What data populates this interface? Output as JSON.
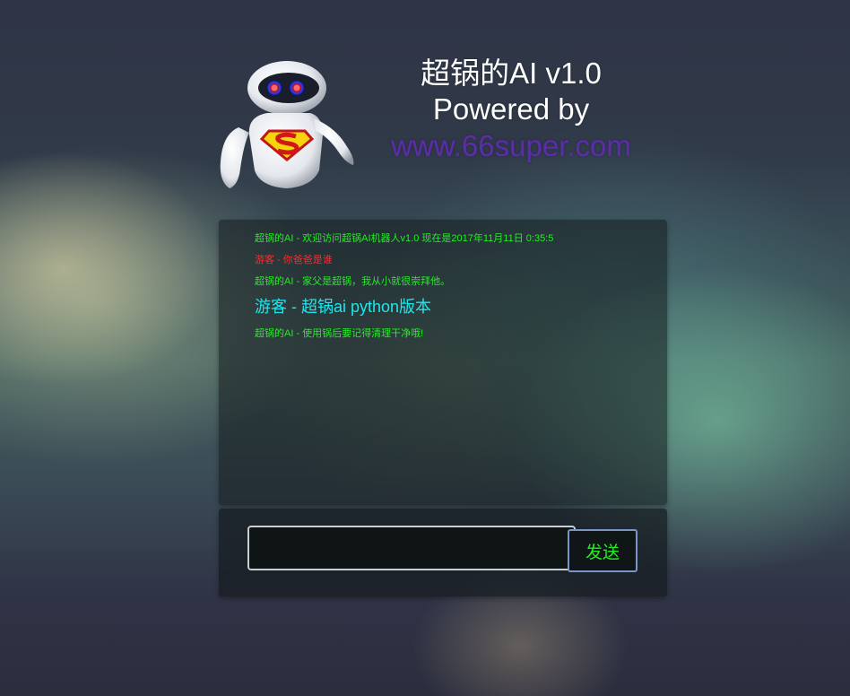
{
  "header": {
    "title": "超锅的AI v1.0",
    "powered": "Powered by",
    "site": "www.66super.com"
  },
  "chat": {
    "messages": [
      {
        "sender": "ai",
        "text": "超锅的AI - 欢迎访问超锅AI机器人v1.0 现在是2017年11月11日 0:35:5"
      },
      {
        "sender": "guest",
        "text": "游客 - 你爸爸是谁"
      },
      {
        "sender": "ai",
        "text": "超锅的AI - 家父是超锅，我从小就很崇拜他。"
      },
      {
        "sender": "guest",
        "text": "游客 - 超锅ai python版本"
      },
      {
        "sender": "ai",
        "text": "超锅的AI - 使用锅后要记得清理干净哦!"
      }
    ]
  },
  "input": {
    "value": "",
    "placeholder": ""
  },
  "send_button": {
    "label": "发送"
  },
  "colors": {
    "ai_message": "#22ee22",
    "guest_message": "#ff2a2a",
    "guest_highlight": "#1ee6ee",
    "site_link": "#5b2ea8"
  },
  "icons": {
    "logo": "robot-superman-icon"
  }
}
